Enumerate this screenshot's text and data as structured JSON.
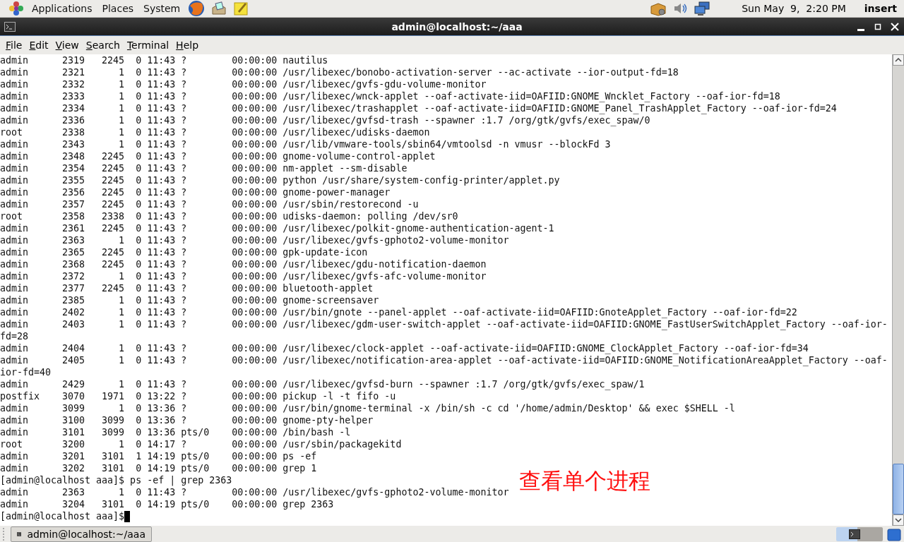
{
  "top_panel": {
    "menus": [
      "Applications",
      "Places",
      "System"
    ],
    "clock": "Sun May  9,  2:20 PM",
    "user": "insert"
  },
  "window": {
    "title": "admin@localhost:~/aaa"
  },
  "menubar": [
    "File",
    "Edit",
    "View",
    "Search",
    "Terminal",
    "Help"
  ],
  "terminal": {
    "lines": [
      {
        "kind": "ps",
        "uid": "admin",
        "pid": "2319",
        "ppid": "2245",
        "c": "0",
        "stime": "11:43",
        "tty": "?",
        "time": "00:00:00",
        "cmd": "nautilus"
      },
      {
        "kind": "ps",
        "uid": "admin",
        "pid": "2321",
        "ppid": "1",
        "c": "0",
        "stime": "11:43",
        "tty": "?",
        "time": "00:00:00",
        "cmd": "/usr/libexec/bonobo-activation-server --ac-activate --ior-output-fd=18"
      },
      {
        "kind": "ps",
        "uid": "admin",
        "pid": "2332",
        "ppid": "1",
        "c": "0",
        "stime": "11:43",
        "tty": "?",
        "time": "00:00:00",
        "cmd": "/usr/libexec/gvfs-gdu-volume-monitor"
      },
      {
        "kind": "ps",
        "uid": "admin",
        "pid": "2333",
        "ppid": "1",
        "c": "0",
        "stime": "11:43",
        "tty": "?",
        "time": "00:00:00",
        "cmd": "/usr/libexec/wnck-applet --oaf-activate-iid=OAFIID:GNOME_Wncklet_Factory --oaf-ior-fd=18"
      },
      {
        "kind": "ps",
        "uid": "admin",
        "pid": "2334",
        "ppid": "1",
        "c": "0",
        "stime": "11:43",
        "tty": "?",
        "time": "00:00:00",
        "cmd": "/usr/libexec/trashapplet --oaf-activate-iid=OAFIID:GNOME_Panel_TrashApplet_Factory --oaf-ior-fd=24"
      },
      {
        "kind": "ps",
        "uid": "admin",
        "pid": "2336",
        "ppid": "1",
        "c": "0",
        "stime": "11:43",
        "tty": "?",
        "time": "00:00:00",
        "cmd": "/usr/libexec/gvfsd-trash --spawner :1.7 /org/gtk/gvfs/exec_spaw/0"
      },
      {
        "kind": "ps",
        "uid": "root",
        "pid": "2338",
        "ppid": "1",
        "c": "0",
        "stime": "11:43",
        "tty": "?",
        "time": "00:00:00",
        "cmd": "/usr/libexec/udisks-daemon"
      },
      {
        "kind": "ps",
        "uid": "admin",
        "pid": "2343",
        "ppid": "1",
        "c": "0",
        "stime": "11:43",
        "tty": "?",
        "time": "00:00:00",
        "cmd": "/usr/lib/vmware-tools/sbin64/vmtoolsd -n vmusr --blockFd 3"
      },
      {
        "kind": "ps",
        "uid": "admin",
        "pid": "2348",
        "ppid": "2245",
        "c": "0",
        "stime": "11:43",
        "tty": "?",
        "time": "00:00:00",
        "cmd": "gnome-volume-control-applet"
      },
      {
        "kind": "ps",
        "uid": "admin",
        "pid": "2354",
        "ppid": "2245",
        "c": "0",
        "stime": "11:43",
        "tty": "?",
        "time": "00:00:00",
        "cmd": "nm-applet --sm-disable"
      },
      {
        "kind": "ps",
        "uid": "admin",
        "pid": "2355",
        "ppid": "2245",
        "c": "0",
        "stime": "11:43",
        "tty": "?",
        "time": "00:00:00",
        "cmd": "python /usr/share/system-config-printer/applet.py"
      },
      {
        "kind": "ps",
        "uid": "admin",
        "pid": "2356",
        "ppid": "2245",
        "c": "0",
        "stime": "11:43",
        "tty": "?",
        "time": "00:00:00",
        "cmd": "gnome-power-manager"
      },
      {
        "kind": "ps",
        "uid": "admin",
        "pid": "2357",
        "ppid": "2245",
        "c": "0",
        "stime": "11:43",
        "tty": "?",
        "time": "00:00:00",
        "cmd": "/usr/sbin/restorecond -u"
      },
      {
        "kind": "ps",
        "uid": "root",
        "pid": "2358",
        "ppid": "2338",
        "c": "0",
        "stime": "11:43",
        "tty": "?",
        "time": "00:00:00",
        "cmd": "udisks-daemon: polling /dev/sr0"
      },
      {
        "kind": "ps",
        "uid": "admin",
        "pid": "2361",
        "ppid": "2245",
        "c": "0",
        "stime": "11:43",
        "tty": "?",
        "time": "00:00:00",
        "cmd": "/usr/libexec/polkit-gnome-authentication-agent-1"
      },
      {
        "kind": "ps",
        "uid": "admin",
        "pid": "2363",
        "ppid": "1",
        "c": "0",
        "stime": "11:43",
        "tty": "?",
        "time": "00:00:00",
        "cmd": "/usr/libexec/gvfs-gphoto2-volume-monitor"
      },
      {
        "kind": "ps",
        "uid": "admin",
        "pid": "2365",
        "ppid": "2245",
        "c": "0",
        "stime": "11:43",
        "tty": "?",
        "time": "00:00:00",
        "cmd": "gpk-update-icon"
      },
      {
        "kind": "ps",
        "uid": "admin",
        "pid": "2368",
        "ppid": "2245",
        "c": "0",
        "stime": "11:43",
        "tty": "?",
        "time": "00:00:00",
        "cmd": "/usr/libexec/gdu-notification-daemon"
      },
      {
        "kind": "ps",
        "uid": "admin",
        "pid": "2372",
        "ppid": "1",
        "c": "0",
        "stime": "11:43",
        "tty": "?",
        "time": "00:00:00",
        "cmd": "/usr/libexec/gvfs-afc-volume-monitor"
      },
      {
        "kind": "ps",
        "uid": "admin",
        "pid": "2377",
        "ppid": "2245",
        "c": "0",
        "stime": "11:43",
        "tty": "?",
        "time": "00:00:00",
        "cmd": "bluetooth-applet"
      },
      {
        "kind": "ps",
        "uid": "admin",
        "pid": "2385",
        "ppid": "1",
        "c": "0",
        "stime": "11:43",
        "tty": "?",
        "time": "00:00:00",
        "cmd": "gnome-screensaver"
      },
      {
        "kind": "ps",
        "uid": "admin",
        "pid": "2402",
        "ppid": "1",
        "c": "0",
        "stime": "11:43",
        "tty": "?",
        "time": "00:00:00",
        "cmd": "/usr/bin/gnote --panel-applet --oaf-activate-iid=OAFIID:GnoteApplet_Factory --oaf-ior-fd=22"
      },
      {
        "kind": "ps",
        "uid": "admin",
        "pid": "2403",
        "ppid": "1",
        "c": "0",
        "stime": "11:43",
        "tty": "?",
        "time": "00:00:00",
        "cmd": "/usr/libexec/gdm-user-switch-applet --oaf-activate-iid=OAFIID:GNOME_FastUserSwitchApplet_Factory --oaf-ior-"
      },
      {
        "kind": "wrap",
        "text": "fd=28"
      },
      {
        "kind": "ps",
        "uid": "admin",
        "pid": "2404",
        "ppid": "1",
        "c": "0",
        "stime": "11:43",
        "tty": "?",
        "time": "00:00:00",
        "cmd": "/usr/libexec/clock-applet --oaf-activate-iid=OAFIID:GNOME_ClockApplet_Factory --oaf-ior-fd=34"
      },
      {
        "kind": "ps",
        "uid": "admin",
        "pid": "2405",
        "ppid": "1",
        "c": "0",
        "stime": "11:43",
        "tty": "?",
        "time": "00:00:00",
        "cmd": "/usr/libexec/notification-area-applet --oaf-activate-iid=OAFIID:GNOME_NotificationAreaApplet_Factory --oaf-"
      },
      {
        "kind": "wrap",
        "text": "ior-fd=40"
      },
      {
        "kind": "ps",
        "uid": "admin",
        "pid": "2429",
        "ppid": "1",
        "c": "0",
        "stime": "11:43",
        "tty": "?",
        "time": "00:00:00",
        "cmd": "/usr/libexec/gvfsd-burn --spawner :1.7 /org/gtk/gvfs/exec_spaw/1"
      },
      {
        "kind": "ps",
        "uid": "postfix",
        "pid": "3070",
        "ppid": "1971",
        "c": "0",
        "stime": "13:22",
        "tty": "?",
        "time": "00:00:00",
        "cmd": "pickup -l -t fifo -u"
      },
      {
        "kind": "ps",
        "uid": "admin",
        "pid": "3099",
        "ppid": "1",
        "c": "0",
        "stime": "13:36",
        "tty": "?",
        "time": "00:00:00",
        "cmd": "/usr/bin/gnome-terminal -x /bin/sh -c cd '/home/admin/Desktop' && exec $SHELL -l"
      },
      {
        "kind": "ps",
        "uid": "admin",
        "pid": "3100",
        "ppid": "3099",
        "c": "0",
        "stime": "13:36",
        "tty": "?",
        "time": "00:00:00",
        "cmd": "gnome-pty-helper"
      },
      {
        "kind": "ps",
        "uid": "admin",
        "pid": "3101",
        "ppid": "3099",
        "c": "0",
        "stime": "13:36",
        "tty": "pts/0",
        "time": "00:00:00",
        "cmd": "/bin/bash -l"
      },
      {
        "kind": "ps",
        "uid": "root",
        "pid": "3200",
        "ppid": "1",
        "c": "0",
        "stime": "14:17",
        "tty": "?",
        "time": "00:00:00",
        "cmd": "/usr/sbin/packagekitd"
      },
      {
        "kind": "ps",
        "uid": "admin",
        "pid": "3201",
        "ppid": "3101",
        "c": "1",
        "stime": "14:19",
        "tty": "pts/0",
        "time": "00:00:00",
        "cmd": "ps -ef"
      },
      {
        "kind": "ps",
        "uid": "admin",
        "pid": "3202",
        "ppid": "3101",
        "c": "0",
        "stime": "14:19",
        "tty": "pts/0",
        "time": "00:00:00",
        "cmd": "grep 1"
      },
      {
        "kind": "prompt",
        "text": "[admin@localhost aaa]$ ps -ef | grep 2363"
      },
      {
        "kind": "ps",
        "uid": "admin",
        "pid": "2363",
        "ppid": "1",
        "c": "0",
        "stime": "11:43",
        "tty": "?",
        "time": "00:00:00",
        "cmd": "/usr/libexec/gvfs-gphoto2-volume-monitor"
      },
      {
        "kind": "ps",
        "uid": "admin",
        "pid": "3204",
        "ppid": "3101",
        "c": "0",
        "stime": "14:19",
        "tty": "pts/0",
        "time": "00:00:00",
        "cmd": "grep 2363"
      },
      {
        "kind": "prompt",
        "text": "[admin@localhost aaa]$",
        "cursor": true
      }
    ]
  },
  "annotation": {
    "text": "查看单个进程"
  },
  "taskbar": {
    "tasks": [
      {
        "label": "admin@localhost:~/aaa",
        "selected": false
      }
    ]
  }
}
